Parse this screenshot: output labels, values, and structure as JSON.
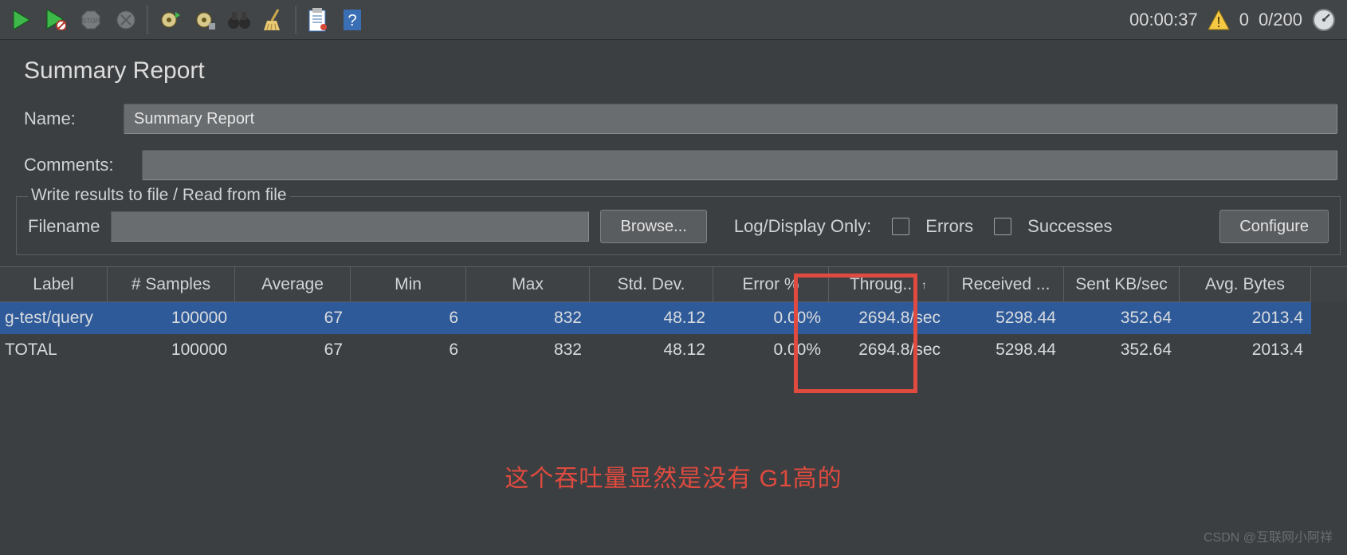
{
  "toolbar": {
    "time": "00:00:37",
    "warn_count": "0",
    "threads": "0/200"
  },
  "panel": {
    "title": "Summary Report",
    "name_label": "Name:",
    "name_value": "Summary Report",
    "comments_label": "Comments:",
    "comments_value": ""
  },
  "file_section": {
    "legend": "Write results to file / Read from file",
    "filename_label": "Filename",
    "filename_value": "",
    "browse": "Browse...",
    "logdisplay": "Log/Display Only:",
    "errors": "Errors",
    "successes": "Successes",
    "configure": "Configure"
  },
  "table": {
    "headers": [
      "Label",
      "# Samples",
      "Average",
      "Min",
      "Max",
      "Std. Dev.",
      "Error %",
      "Throug...",
      "Received ...",
      "Sent KB/sec",
      "Avg. Bytes"
    ],
    "sort_indicator": "↑",
    "sorted_col": 7,
    "rows": [
      {
        "cells": [
          "ɡ-test/query",
          "100000",
          "67",
          "6",
          "832",
          "48.12",
          "0.00%",
          "2694.8/sec",
          "5298.44",
          "352.64",
          "2013.4"
        ],
        "selected": true
      },
      {
        "cells": [
          "TOTAL",
          "100000",
          "67",
          "6",
          "832",
          "48.12",
          "0.00%",
          "2694.8/sec",
          "5298.44",
          "352.64",
          "2013.4"
        ],
        "selected": false
      }
    ]
  },
  "annotation": "这个吞吐量显然是没有 G1高的",
  "watermark": "CSDN @互联网小阿祥",
  "icons": {
    "run": "run-icon",
    "run_ex": "run-exclude-icon",
    "stop": "stop-icon",
    "shutdown": "shutdown-icon",
    "gear1": "gear-run-icon",
    "gear2": "gear-settings-icon",
    "search": "binoculars-icon",
    "clear": "broom-icon",
    "notes": "clipboard-icon",
    "help": "help-icon",
    "warn": "warning-icon",
    "gauge": "gauge-icon"
  }
}
